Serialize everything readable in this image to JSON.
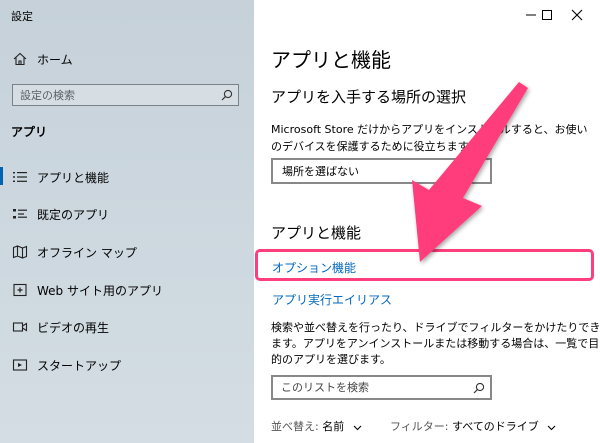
{
  "window": {
    "title": "設定"
  },
  "sidebar": {
    "home_label": "ホーム",
    "search_placeholder": "設定の検索",
    "section_label": "アプリ",
    "items": [
      {
        "label": "アプリと機能",
        "icon": "list-icon",
        "selected": true
      },
      {
        "label": "既定のアプリ",
        "icon": "default-apps-icon",
        "selected": false
      },
      {
        "label": "オフライン マップ",
        "icon": "map-icon",
        "selected": false
      },
      {
        "label": "Web サイト用のアプリ",
        "icon": "web-app-icon",
        "selected": false
      },
      {
        "label": "ビデオの再生",
        "icon": "video-icon",
        "selected": false
      },
      {
        "label": "スタートアップ",
        "icon": "startup-icon",
        "selected": false
      }
    ]
  },
  "main": {
    "page_title": "アプリと機能",
    "install_section": {
      "heading": "アプリを入手する場所の選択",
      "description": "Microsoft Store だけからアプリをインストールすると、お使いのデバイスを保護するために役立ちます。",
      "dropdown_value": "場所を選ばない"
    },
    "apps_section": {
      "heading": "アプリと機能",
      "link_optional_features": "オプション機能",
      "link_app_execution_aliases": "アプリ実行エイリアス",
      "description": "検索や並べ替えを行ったり、ドライブでフィルターをかけたりできます。アプリをアンインストールまたは移動する場合は、一覧で目的のアプリを選びます。",
      "search_placeholder": "このリストを検索",
      "sort_label": "並べ替え:",
      "sort_value": "名前",
      "filter_label": "フィルター:",
      "filter_value": "すべてのドライブ"
    }
  },
  "colors": {
    "accent": "#0063b1",
    "link": "#0067c0",
    "annotation": "#ff3e7d"
  }
}
